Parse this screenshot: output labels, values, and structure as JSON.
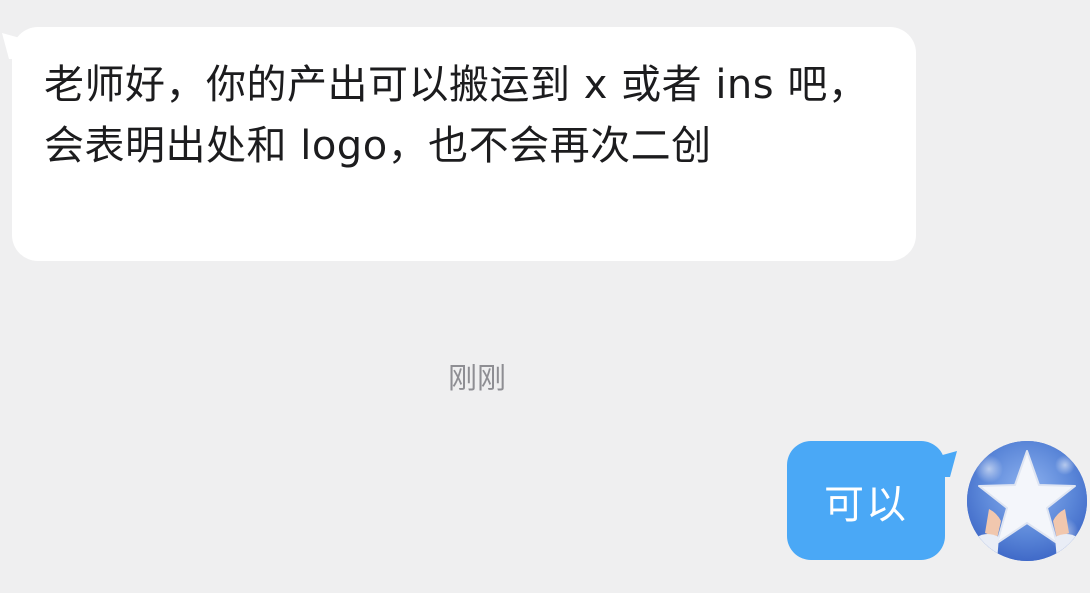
{
  "messages": {
    "incoming": {
      "text": "老师好，你的产出可以搬运到 x 或者 ins 吧，会表明出处和 logo，也不会再次二创"
    },
    "timestamp": "刚刚",
    "outgoing": {
      "text": "可以"
    }
  },
  "avatar": {
    "icon": "star-avatar-icon"
  },
  "colors": {
    "background": "#efeff0",
    "incoming_bubble": "#ffffff",
    "outgoing_bubble": "#4aa8f6",
    "timestamp": "#8e8e93",
    "avatar_bg": "#4b74cf"
  }
}
